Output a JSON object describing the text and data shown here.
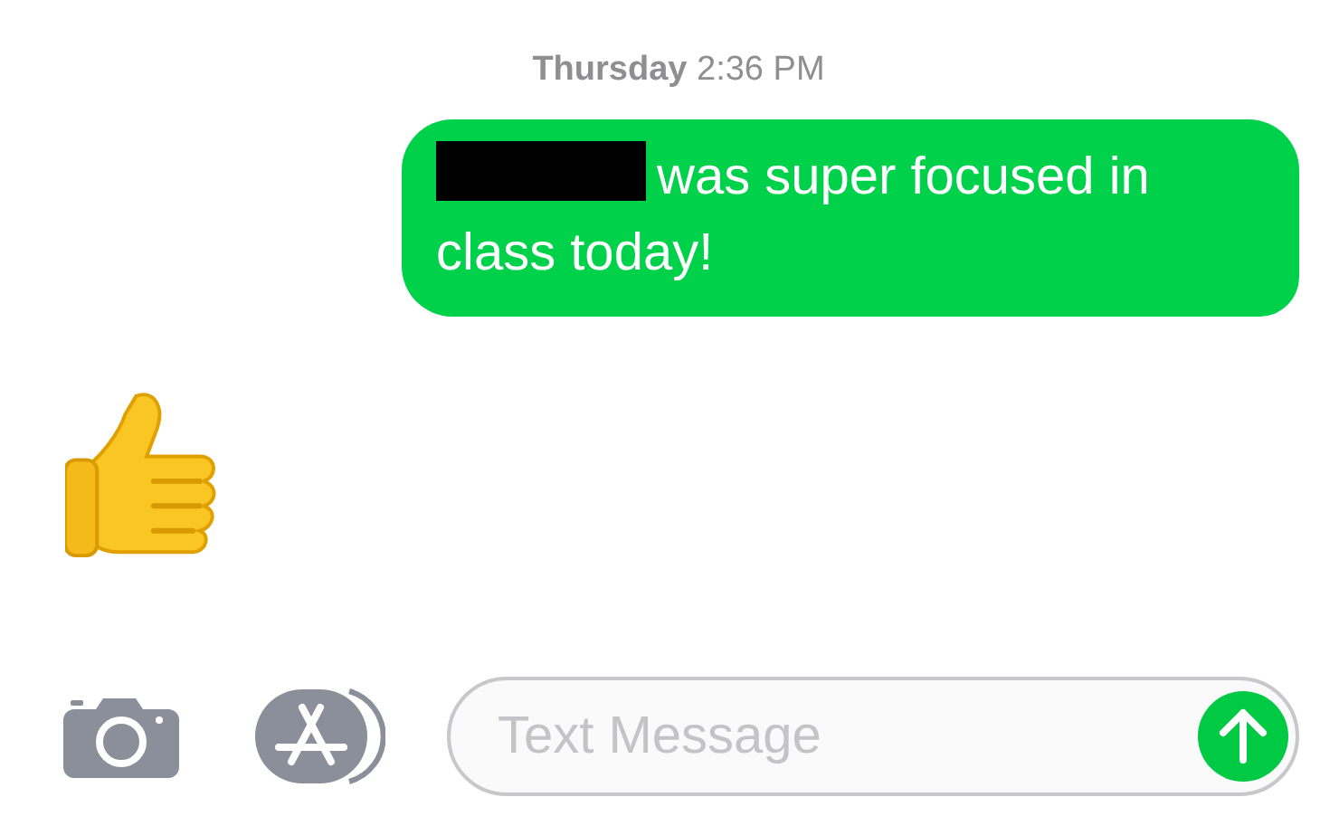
{
  "timestamp": "**Thursday** 2:36 PM",
  "messages": [
    {
      "kind": "text",
      "outgoing": true,
      "redacted_prefix": true,
      "text": "was super focused in class today!"
    },
    {
      "kind": "thumbs-up",
      "outgoing": false
    }
  ],
  "composer": {
    "placeholder": "Text Message"
  }
}
